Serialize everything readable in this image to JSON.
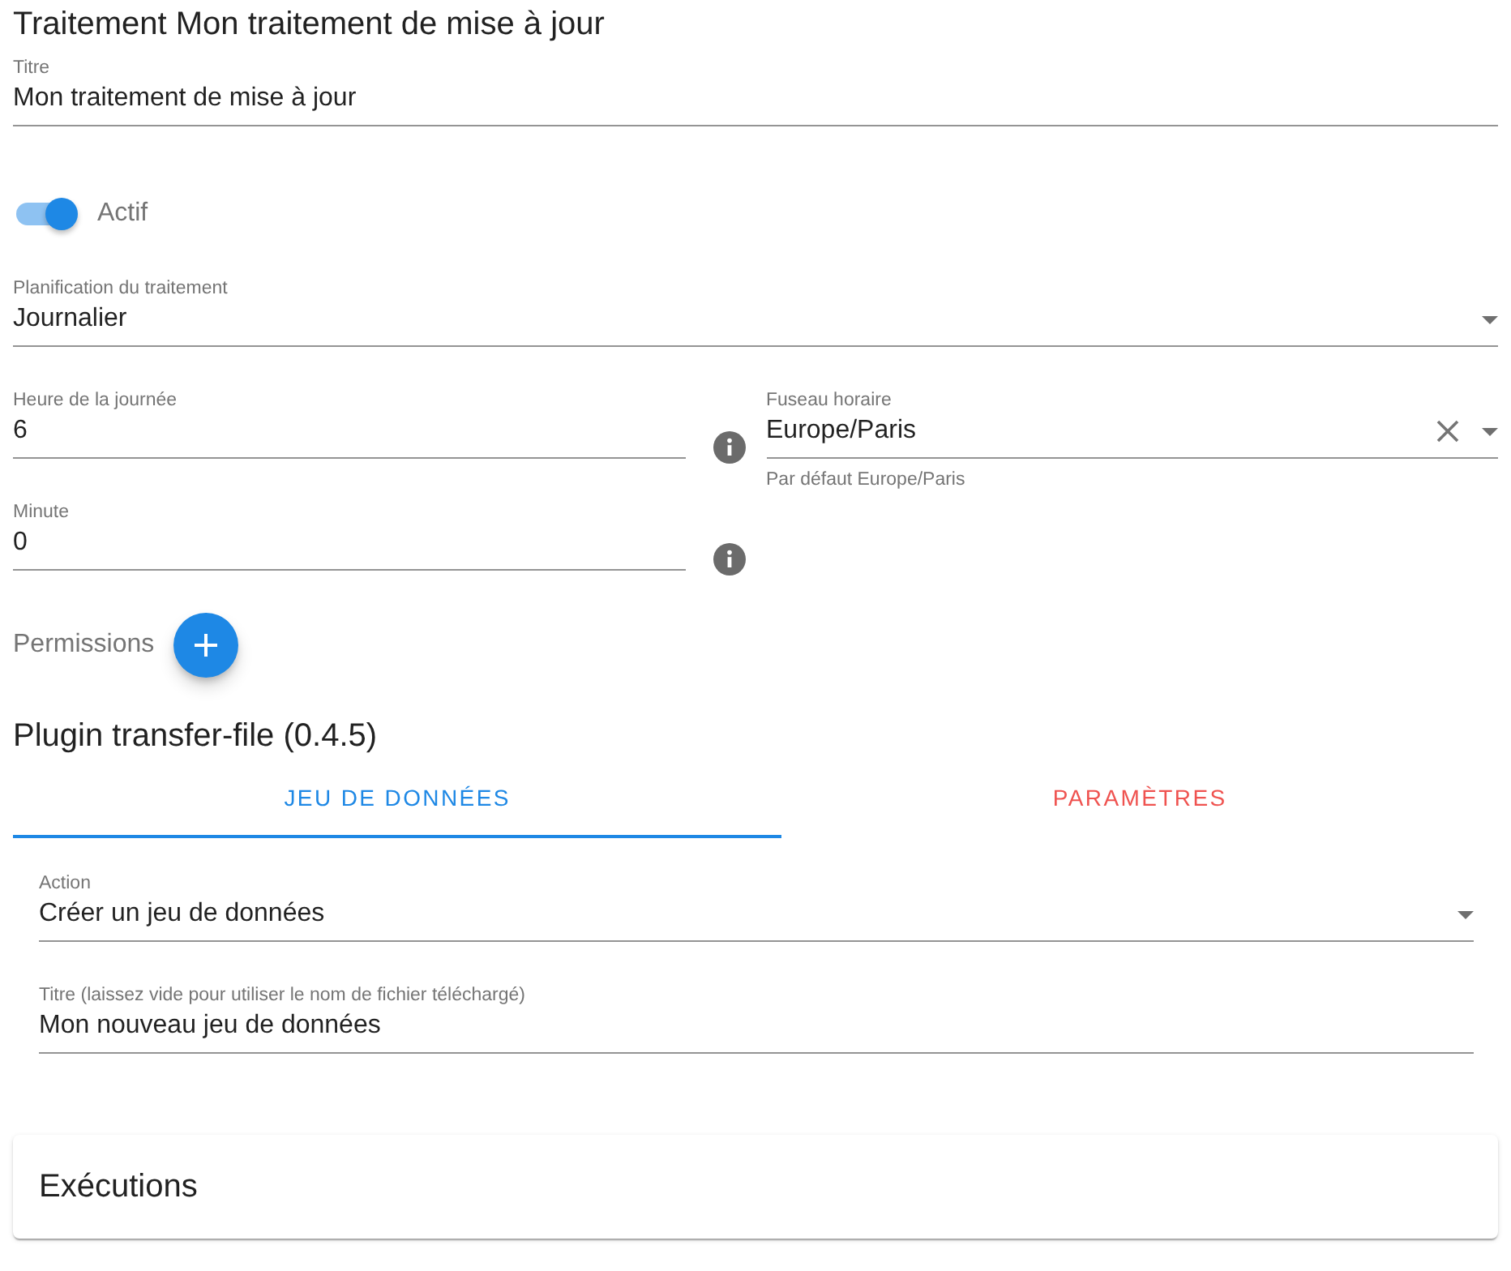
{
  "title": "Traitement Mon traitement de mise à jour",
  "title_field": {
    "kind": "text",
    "label": "Titre",
    "value": "Mon traitement de mise à jour"
  },
  "active_switch": {
    "label": "Actif",
    "on": true
  },
  "schedule": {
    "kind": "select",
    "label": "Planification du traitement",
    "value": "Journalier"
  },
  "hour_field": {
    "kind": "text",
    "label": "Heure de la journée",
    "value": "6"
  },
  "timezone": {
    "kind": "autocomplete",
    "label": "Fuseau horaire",
    "value": "Europe/Paris",
    "hint": "Par défaut Europe/Paris"
  },
  "minute_field": {
    "kind": "text",
    "label": "Minute",
    "value": "0"
  },
  "permissions": {
    "label": "Permissions"
  },
  "plugin": {
    "title": "Plugin transfer-file (0.4.5)",
    "tabs": [
      {
        "label": "JEU DE DONNÉES",
        "selected": true,
        "error": false
      },
      {
        "label": "PARAMÈTRES",
        "selected": false,
        "error": true
      }
    ],
    "fields": [
      {
        "kind": "select",
        "label": "Action",
        "value": "Créer un jeu de données"
      },
      {
        "kind": "text",
        "label": "Titre (laissez vide pour utiliser le nom de fichier téléchargé)",
        "value": "Mon nouveau jeu de données"
      }
    ]
  },
  "executions": {
    "title": "Exécutions"
  }
}
